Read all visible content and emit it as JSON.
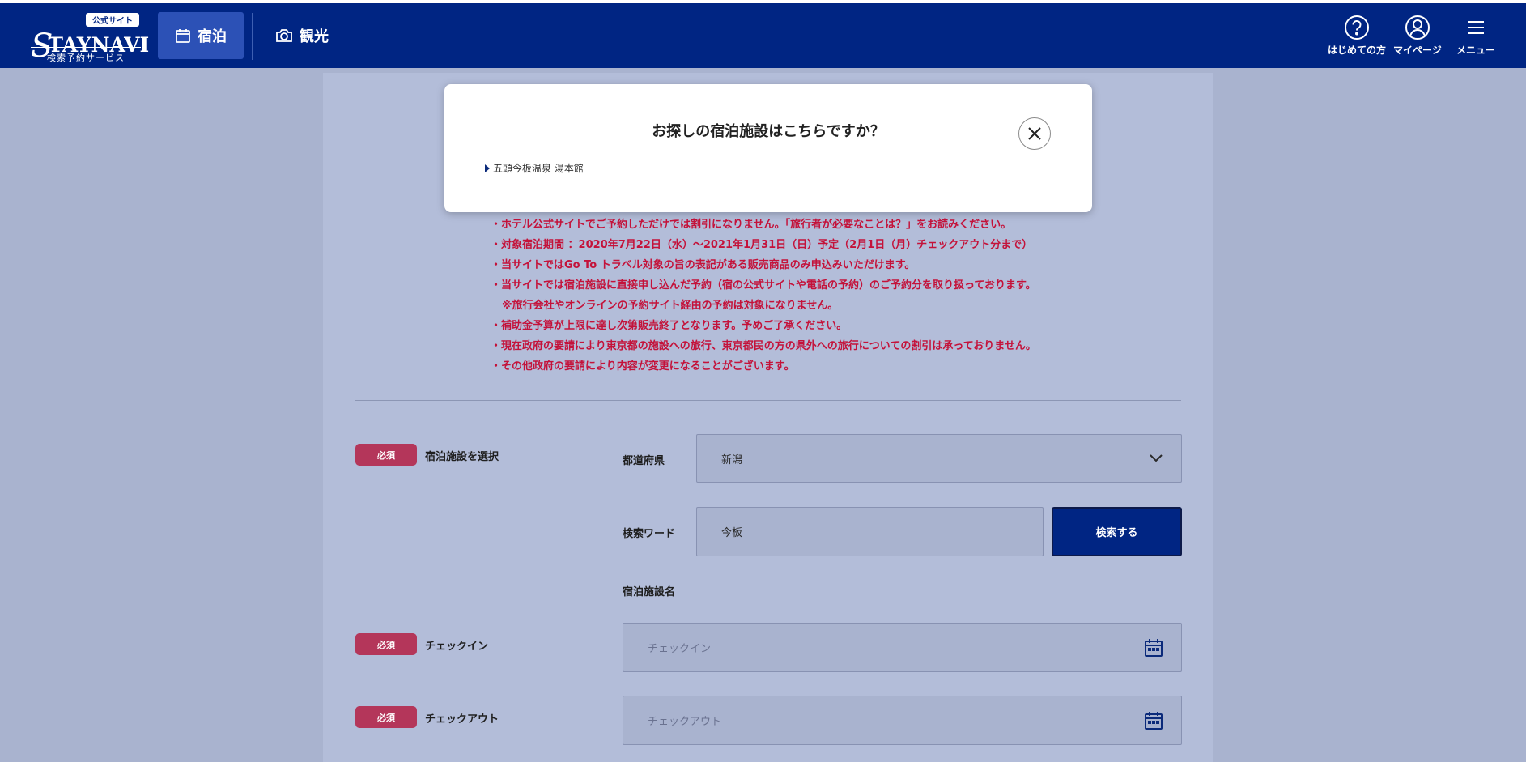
{
  "header": {
    "logo_badge": "公式サイト",
    "logo_initial": "S",
    "logo_text": "TAYNAVI",
    "logo_sub": "検索予約サービス",
    "tabs": [
      {
        "label": "宿泊",
        "icon": "calendar-icon"
      },
      {
        "label": "観光",
        "icon": "camera-icon"
      }
    ],
    "right_icons": [
      {
        "label": "はじめての方",
        "icon": "question-circle-icon"
      },
      {
        "label": "マイページ",
        "icon": "user-circle-icon"
      },
      {
        "label": "メニュー",
        "icon": "hamburger-menu-icon"
      }
    ]
  },
  "modal": {
    "title": "お探しの宿泊施設はこちらですか？",
    "results": [
      "五頭今板温泉 湯本館"
    ]
  },
  "notice": [
    "・ホテル公式サイトでご予約しただけでは割引になりません。「旅行者が必要なことは？」をお読みください。",
    "・対象宿泊期間 ：2020年7月22日（水）～2021年1月31日（日）予定（2月1日（月）チェックアウト分まで）",
    "・当サイトではGo To トラベル対象の旨の表記がある販売商品のみ申込みいただけます。",
    "・当サイトでは宿泊施設に直接申し込んだ予約（宿の公式サイトや電話の予約）のご予約分を取り扱っております。",
    "※旅行会社やオンラインの予約サイト経由の予約は対象になりません。",
    "・補助金予算が上限に達し次第販売終了となります。予めご了承ください。",
    "・現在政府の要請により東京都の施設への旅行、東京都民の方の県外への旅行についての割引は承っておりません。",
    "・その他政府の要請により内容が変更になることがございます。"
  ],
  "form": {
    "required_label": "必須",
    "facility_select_label": "宿泊施設を選択",
    "prefecture_label": "都道府県",
    "prefecture_value": "新潟",
    "keyword_label": "検索ワード",
    "keyword_value": "今板",
    "search_button": "検索する",
    "facility_name_label": "宿泊施設名",
    "checkin_label": "チェックイン",
    "checkin_placeholder": "チェックイン",
    "checkout_label": "チェックアウト",
    "checkout_placeholder": "チェックアウト"
  },
  "colors": {
    "header_bg": "#002583",
    "active_tab": "#2c51b6",
    "required_badge": "#b4365a",
    "notice_text": "#c4123a"
  }
}
